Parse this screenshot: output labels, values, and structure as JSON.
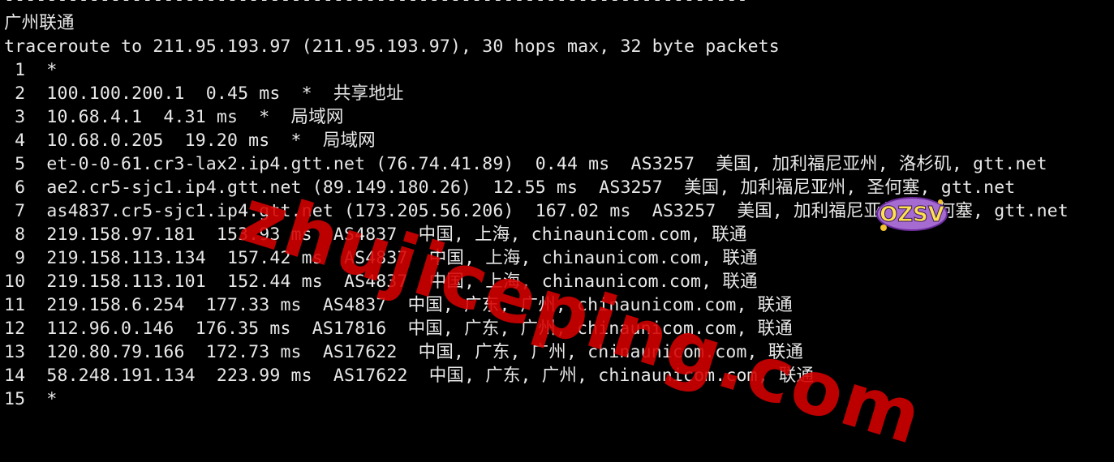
{
  "terminal": {
    "lines": [
      "----------------------------------------------------------------------",
      "广州联通",
      "traceroute to 211.95.193.97 (211.95.193.97), 30 hops max, 32 byte packets",
      " 1  *",
      " 2  100.100.200.1  0.45 ms  *  共享地址",
      " 3  10.68.4.1  4.31 ms  *  局域网",
      " 4  10.68.0.205  19.20 ms  *  局域网",
      " 5  et-0-0-61.cr3-lax2.ip4.gtt.net (76.74.41.89)  0.44 ms  AS3257  美国, 加利福尼亚州, 洛杉矶, gtt.net",
      " 6  ae2.cr5-sjc1.ip4.gtt.net (89.149.180.26)  12.55 ms  AS3257  美国, 加利福尼亚州, 圣何塞, gtt.net",
      " 7  as4837.cr5-sjc1.ip4.gtt.net (173.205.56.206)  167.02 ms  AS3257  美国, 加利福尼亚州, 圣何塞, gtt.net",
      " 8  219.158.97.181  153.93 ms  AS4837  中国, 上海, chinaunicom.com, 联通",
      " 9  219.158.113.134  157.42 ms  AS4837  中国, 上海, chinaunicom.com, 联通",
      "10  219.158.113.101  152.44 ms  AS4837  中国, 上海, chinaunicom.com, 联通",
      "11  219.158.6.254  177.33 ms  AS4837  中国, 广东, 广州, chinaunicom.com, 联通",
      "12  112.96.0.146  176.35 ms  AS17816  中国, 广东, 广州, chinaunicom.com, 联通",
      "13  120.80.79.166  172.73 ms  AS17622  中国, 广东, 广州, chinaunicom.com, 联通",
      "14  58.248.191.134  223.99 ms  AS17622  中国, 广东, 广州, chinaunicom.com, 联通",
      "15  *"
    ]
  },
  "watermark": {
    "text": "zhujiceping.com",
    "color": "#d60000"
  },
  "logo": {
    "text": "OZSV",
    "icon": "ozsv-logo"
  },
  "colors": {
    "background": "#000000",
    "foreground": "#e8e8e8"
  }
}
